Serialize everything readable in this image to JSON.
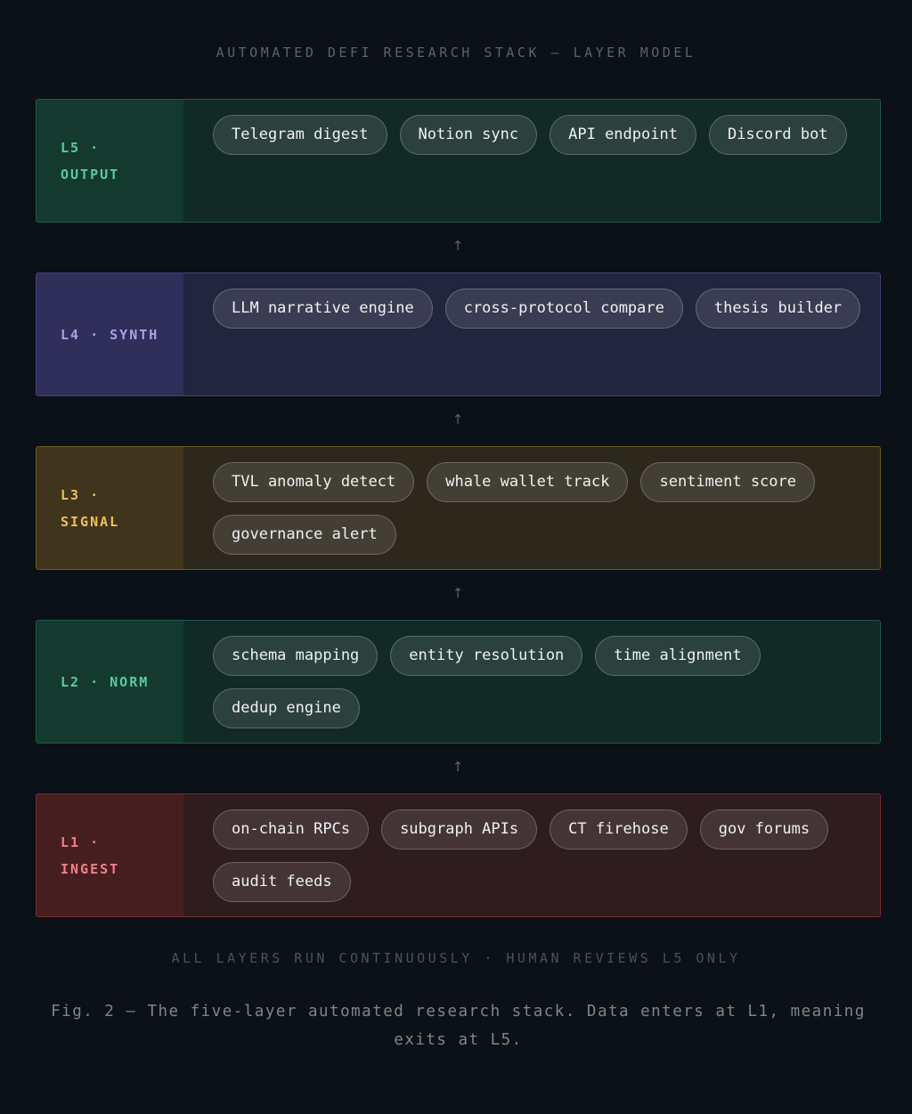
{
  "title": "AUTOMATED DEFI RESEARCH STACK — LAYER MODEL",
  "layers": [
    {
      "label": "L5 · OUTPUT",
      "items": [
        "Telegram digest",
        "Notion sync",
        "API endpoint",
        "Discord bot"
      ]
    },
    {
      "label": "L4 · SYNTH",
      "items": [
        "LLM narrative engine",
        "cross-protocol compare",
        "thesis builder"
      ]
    },
    {
      "label": "L3 · SIGNAL",
      "items": [
        "TVL anomaly detect",
        "whale wallet track",
        "sentiment score",
        "governance alert"
      ]
    },
    {
      "label": "L2 · NORM",
      "items": [
        "schema mapping",
        "entity resolution",
        "time alignment",
        "dedup engine"
      ]
    },
    {
      "label": "L1 · INGEST",
      "items": [
        "on-chain RPCs",
        "subgraph APIs",
        "CT firehose",
        "gov forums",
        "audit feeds"
      ]
    }
  ],
  "arrow_glyph": "↑",
  "footer": "ALL LAYERS RUN CONTINUOUSLY · HUMAN REVIEWS L5 ONLY",
  "caption": "Fig. 2 — The five-layer automated research stack. Data enters at L1, meaning exits at L5.",
  "colors": {
    "background": "#0c1017",
    "output_green": "#5ccaa0",
    "synth_purple": "#a9a2e6",
    "signal_amber": "#f0c05c",
    "ingest_red": "#f0808a"
  }
}
